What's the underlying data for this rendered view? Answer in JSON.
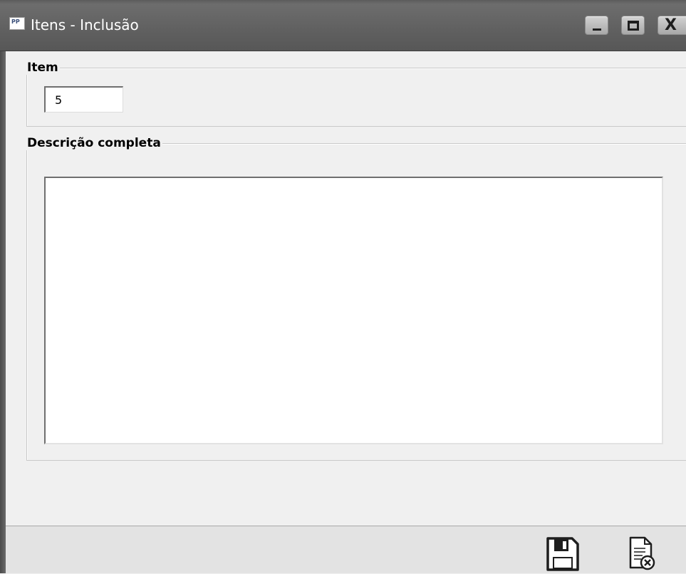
{
  "window": {
    "app_icon_text": "PP",
    "title": "Itens - Inclusão",
    "controls": {
      "minimize_icon": "minimize-icon",
      "maximize_icon": "maximize-icon",
      "close_icon": "close-icon",
      "close_glyph": "X"
    }
  },
  "form": {
    "item_group_label": "Item",
    "item_value": "5",
    "description_group_label": "Descrição completa",
    "description_value": ""
  },
  "toolbar": {
    "save_icon": "floppy-disk-icon",
    "cancel_icon": "document-cancel-icon"
  },
  "colors": {
    "titlebar": "#606060",
    "background": "#f0f0f0",
    "bottom_bar": "#e3e3e3"
  }
}
